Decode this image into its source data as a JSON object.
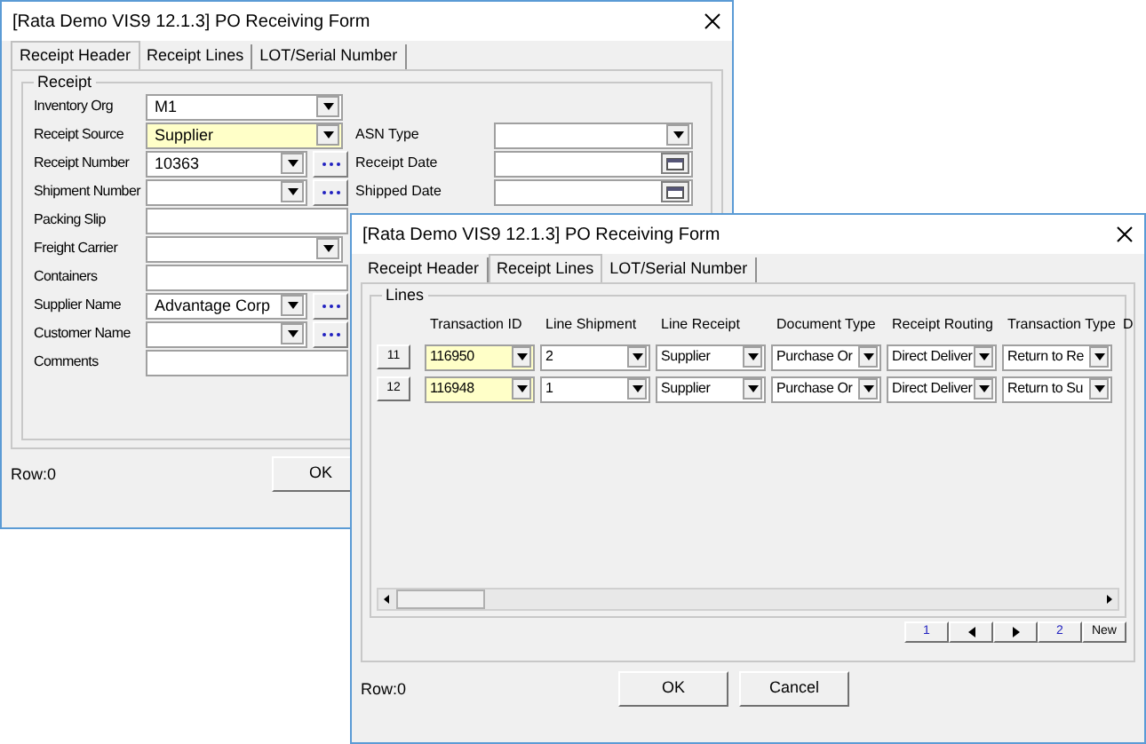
{
  "back_window": {
    "title": "[Rata Demo VIS9 12.1.3] PO Receiving Form",
    "tabs": [
      {
        "label": "Receipt Header",
        "selected": true
      },
      {
        "label": "Receipt Lines",
        "selected": false
      },
      {
        "label": "LOT/Serial Number",
        "selected": false
      }
    ],
    "group_title": "Receipt",
    "rows": [
      {
        "label": "Inventory Org",
        "kind": "combo",
        "value": "M1",
        "highlighted": false,
        "lookup": false
      },
      {
        "label": "Receipt Source",
        "kind": "combo",
        "value": "Supplier",
        "highlighted": true,
        "lookup": false,
        "right": {
          "label": "ASN Type",
          "kind": "combo"
        }
      },
      {
        "label": "Receipt Number",
        "kind": "combo",
        "value": "10363",
        "highlighted": false,
        "lookup": true,
        "right": {
          "label": "Receipt Date",
          "kind": "date"
        }
      },
      {
        "label": "Shipment Number",
        "kind": "combo",
        "highlighted": false,
        "lookup": true,
        "right": {
          "label": "Shipped Date",
          "kind": "date"
        }
      },
      {
        "label": "Packing Slip",
        "kind": "text",
        "highlighted": false,
        "lookup": false
      },
      {
        "label": "Freight Carrier",
        "kind": "combo",
        "highlighted": false,
        "lookup": false
      },
      {
        "label": "Containers",
        "kind": "text",
        "highlighted": false,
        "lookup": false
      },
      {
        "label": "Supplier Name",
        "kind": "combo",
        "value": "Advantage Corp",
        "highlighted": false,
        "lookup": true
      },
      {
        "label": "Customer Name",
        "kind": "combo",
        "highlighted": false,
        "lookup": true
      },
      {
        "label": "Comments",
        "kind": "text",
        "highlighted": false,
        "lookup": false
      }
    ],
    "status": "Row:0",
    "buttons": [
      "OK"
    ]
  },
  "front_window": {
    "title": "[Rata Demo VIS9 12.1.3] PO Receiving Form",
    "tabs": [
      {
        "label": "Receipt Header",
        "selected": false
      },
      {
        "label": "Receipt Lines",
        "selected": true
      },
      {
        "label": "LOT/Serial Number",
        "selected": false
      }
    ],
    "group_title": "Lines",
    "columns": [
      "Transaction ID",
      "Line Shipment",
      "Line Receipt",
      "Document Type",
      "Receipt Routing",
      "Transaction Type",
      "D"
    ],
    "rows": [
      {
        "number": "11",
        "cells": [
          {
            "value": "116950",
            "highlighted": true
          },
          {
            "value": "2",
            "highlighted": false
          },
          {
            "value": "Supplier",
            "highlighted": false
          },
          {
            "value": "Purchase Or",
            "highlighted": false
          },
          {
            "value": "Direct Deliver",
            "highlighted": false
          },
          {
            "value": "Return to Re",
            "highlighted": false
          }
        ]
      },
      {
        "number": "12",
        "cells": [
          {
            "value": "116948",
            "highlighted": true
          },
          {
            "value": "1",
            "highlighted": false
          },
          {
            "value": "Supplier",
            "highlighted": false
          },
          {
            "value": "Purchase Or",
            "highlighted": false
          },
          {
            "value": "Direct Deliver",
            "highlighted": false
          },
          {
            "value": "Return to Su",
            "highlighted": false
          }
        ]
      }
    ],
    "pager": [
      {
        "kind": "page",
        "label": "1"
      },
      {
        "kind": "prev"
      },
      {
        "kind": "next"
      },
      {
        "kind": "page",
        "label": "2"
      },
      {
        "kind": "button",
        "label": "New"
      }
    ],
    "status": "Row:0",
    "buttons": [
      "OK",
      "Cancel"
    ]
  }
}
